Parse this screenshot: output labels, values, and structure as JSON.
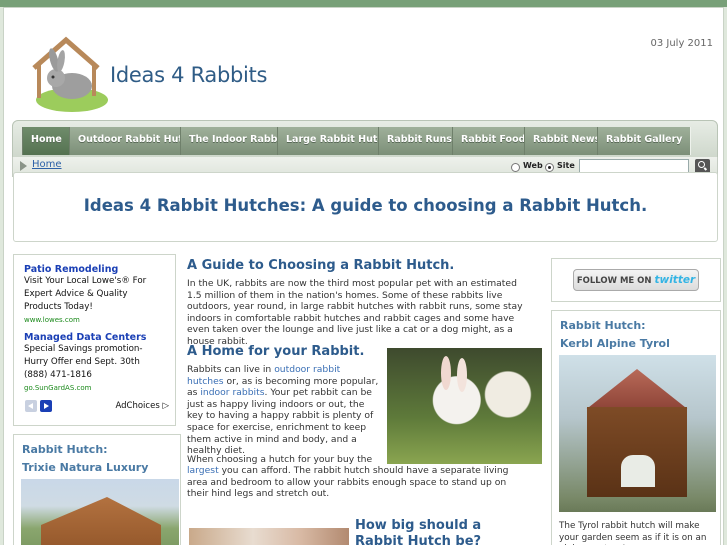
{
  "header": {
    "site_name": "Ideas 4 Rabbits",
    "date": "03 July 2011"
  },
  "nav": {
    "items": [
      {
        "label": "Home",
        "active": true
      },
      {
        "label": "Outdoor Rabbit Hutch"
      },
      {
        "label": "The Indoor Rabbit"
      },
      {
        "label": "Large Rabbit Hutch"
      },
      {
        "label": "Rabbit Runs"
      },
      {
        "label": "Rabbit Food"
      },
      {
        "label": "Rabbit News"
      },
      {
        "label": "Rabbit Gallery"
      }
    ]
  },
  "breadcrumb": {
    "home": "Home"
  },
  "search": {
    "web_label": "Web",
    "site_label": "Site",
    "selected": "Site",
    "placeholder": ""
  },
  "page_title": "Ideas 4 Rabbit Hutches: A guide to choosing a Rabbit Hutch.",
  "ads": {
    "items": [
      {
        "title": "Patio Remodeling",
        "text": "Visit Your Local Lowe's® For Expert Advice & Quality Products Today!",
        "url": "www.lowes.com"
      },
      {
        "title": "Managed Data Centers",
        "text": "Special Savings promotion- Hurry Offer end Sept. 30th (888) 471-1816",
        "url": "go.SunGardAS.com"
      }
    ],
    "adchoices": "AdChoices"
  },
  "left_product": {
    "heading": "Rabbit Hutch:",
    "name": "Trixie Natura Luxury"
  },
  "main": {
    "guide_heading": "A Guide to Choosing a Rabbit Hutch.",
    "guide_text": "In the UK, rabbits are now the third most popular pet with an estimated 1.5 million of them in the nation's homes. Some of these rabbits live outdoors, year round, in large rabbit hutches with rabbit runs, some stay indoors in comfortable rabbit hutches and rabbit cages and some have even taken over the lounge and live just like a cat or a dog might, as a house rabbit.",
    "home_heading": "A Home for your Rabbit.",
    "home_text_1": "Rabbits can live in",
    "home_link_1": "outdoor rabbit hutches",
    "home_text_2": "or, as is becoming more popular, as",
    "home_link_2": "indoor rabbits",
    "home_text_3": ". Your pet rabbit can be just as happy living indoors or out, the key to having a happy rabbit is plenty of space for exercise, enrichment to keep them active in mind and body, and a healthy diet.",
    "choose_text_1": "When choosing a hutch for your buy the",
    "choose_link": "largest",
    "choose_text_2": "you can afford. The rabbit hutch should have a separate living area and bedroom to allow your rabbits enough space to stand up on their hind legs and stretch out.",
    "size_heading": "How big should a Rabbit Hutch be?"
  },
  "twitter": {
    "follow": "FOLLOW ME ON",
    "brand": "twitter"
  },
  "right_product": {
    "heading": "Rabbit Hutch:",
    "name": "Kerbl Alpine Tyrol",
    "caption": "The Tyrol rabbit hutch will make your garden seem as if it is on an alpine pasture!"
  }
}
